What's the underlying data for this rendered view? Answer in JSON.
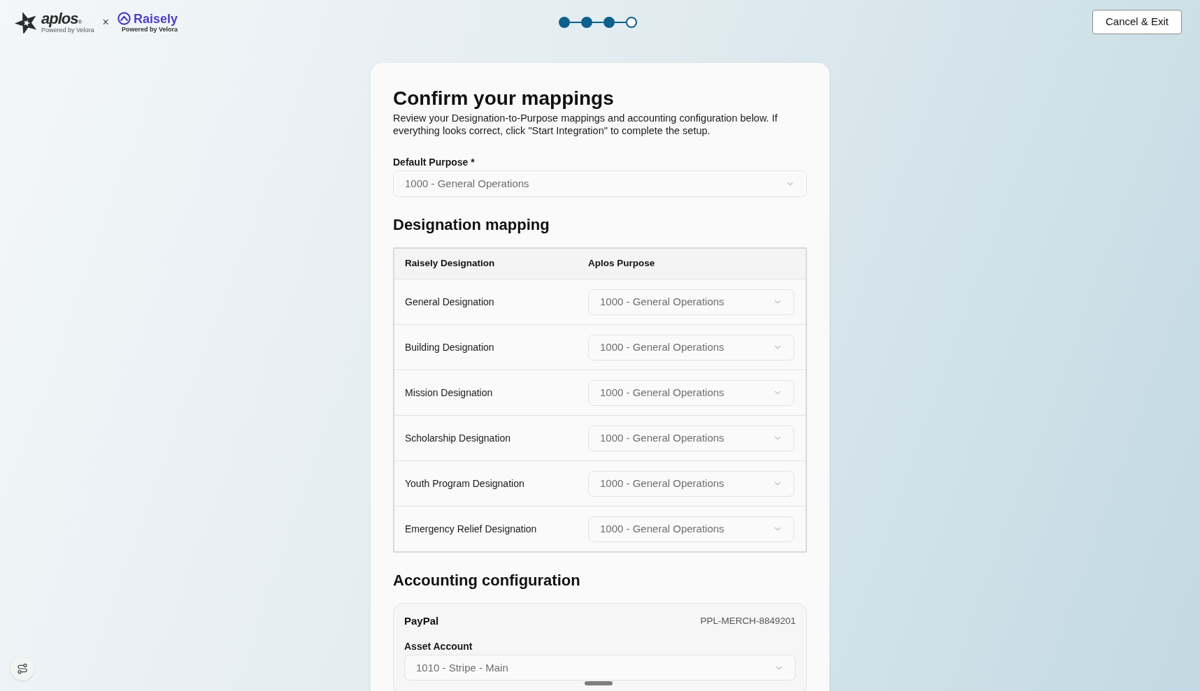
{
  "header": {
    "logos": [
      {
        "kind": "aplos",
        "name": "aplos",
        "mark": "®",
        "tagline": "Powered by Velora"
      },
      {
        "kind": "raisely",
        "name": "Raisely",
        "tagline": "Powered by Velora"
      }
    ],
    "separator": "×",
    "stepper": {
      "steps": [
        {
          "completed": true
        },
        {
          "completed": true
        },
        {
          "completed": true
        },
        {
          "completed": false
        }
      ]
    },
    "cancel_button": "Cancel & Exit"
  },
  "form": {
    "title": "Confirm your mappings",
    "description": "Review your Designation-to-Purpose mappings and accounting configuration below. If everything looks correct, click \"Start Integration\" to complete the setup.",
    "default_purpose": {
      "label": "Default Purpose *",
      "value": "1000 - General Operations"
    },
    "designation_mapping": {
      "heading": "Designation mapping",
      "columns": [
        "Raisely Designation",
        "Aplos Purpose"
      ],
      "rows": [
        {
          "designation": "General Designation",
          "purpose": "1000 - General Operations"
        },
        {
          "designation": "Building Designation",
          "purpose": "1000 - General Operations"
        },
        {
          "designation": "Mission Designation",
          "purpose": "1000 - General Operations"
        },
        {
          "designation": "Scholarship Designation",
          "purpose": "1000 - General Operations"
        },
        {
          "designation": "Youth Program Designation",
          "purpose": "1000 - General Operations"
        },
        {
          "designation": "Emergency Relief Designation",
          "purpose": "1000 - General Operations"
        }
      ]
    },
    "accounting_configuration": {
      "heading": "Accounting configuration",
      "accounts": [
        {
          "name": "PayPal",
          "merchant_id": "PPL-MERCH-8849201",
          "fields": [
            {
              "label": "Asset Account",
              "value": "1010 - Stripe - Main"
            }
          ]
        }
      ]
    }
  }
}
